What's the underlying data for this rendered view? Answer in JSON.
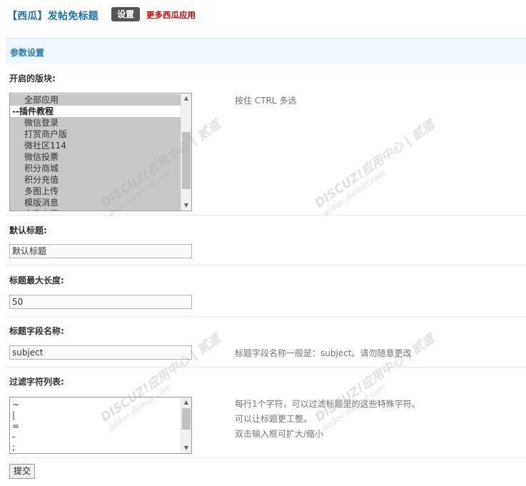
{
  "header": {
    "title": "【西瓜】发帖免标题",
    "tab_label": "设置",
    "more_label": "更多西瓜应用"
  },
  "section": {
    "title": "参数设置"
  },
  "forums": {
    "label": "开启的版块:",
    "hint": "按住 CTRL 多选",
    "items": [
      {
        "label": "全部应用",
        "selected": true,
        "group": false
      },
      {
        "label": "--插件教程",
        "selected": false,
        "group": true
      },
      {
        "label": "微信登录",
        "selected": true,
        "group": false
      },
      {
        "label": "打赏商户版",
        "selected": true,
        "group": false
      },
      {
        "label": "微社区114",
        "selected": true,
        "group": false
      },
      {
        "label": "微信投票",
        "selected": true,
        "group": false
      },
      {
        "label": "积分商城",
        "selected": true,
        "group": false
      },
      {
        "label": "积分充值",
        "selected": true,
        "group": false
      },
      {
        "label": "多图上传",
        "selected": true,
        "group": false
      },
      {
        "label": "模版消息",
        "selected": true,
        "group": false
      },
      {
        "label": "文章专区",
        "selected": true,
        "group": false
      }
    ]
  },
  "default_title": {
    "label": "默认标题:",
    "value": "默认标题"
  },
  "max_length": {
    "label": "标题最大长度:",
    "value": "50"
  },
  "field_name": {
    "label": "标题字段名称:",
    "value": "subject",
    "hint": "标题字段名称一般是：subject。请勿随意更改"
  },
  "filter_chars": {
    "label": "过滤字符列表:",
    "lines": [
      "~",
      "|",
      "=",
      "-",
      ";"
    ],
    "hint_lines": [
      "每行1个字符，可以过滤标题里的这些特殊字符。",
      "可以让标题更工整。",
      "双击输入框可扩大/缩小"
    ]
  },
  "submit_label": "提交",
  "watermark": {
    "brand": "DISCUZ!应用中心 | 贰道",
    "url": "addon.dismall.com"
  }
}
